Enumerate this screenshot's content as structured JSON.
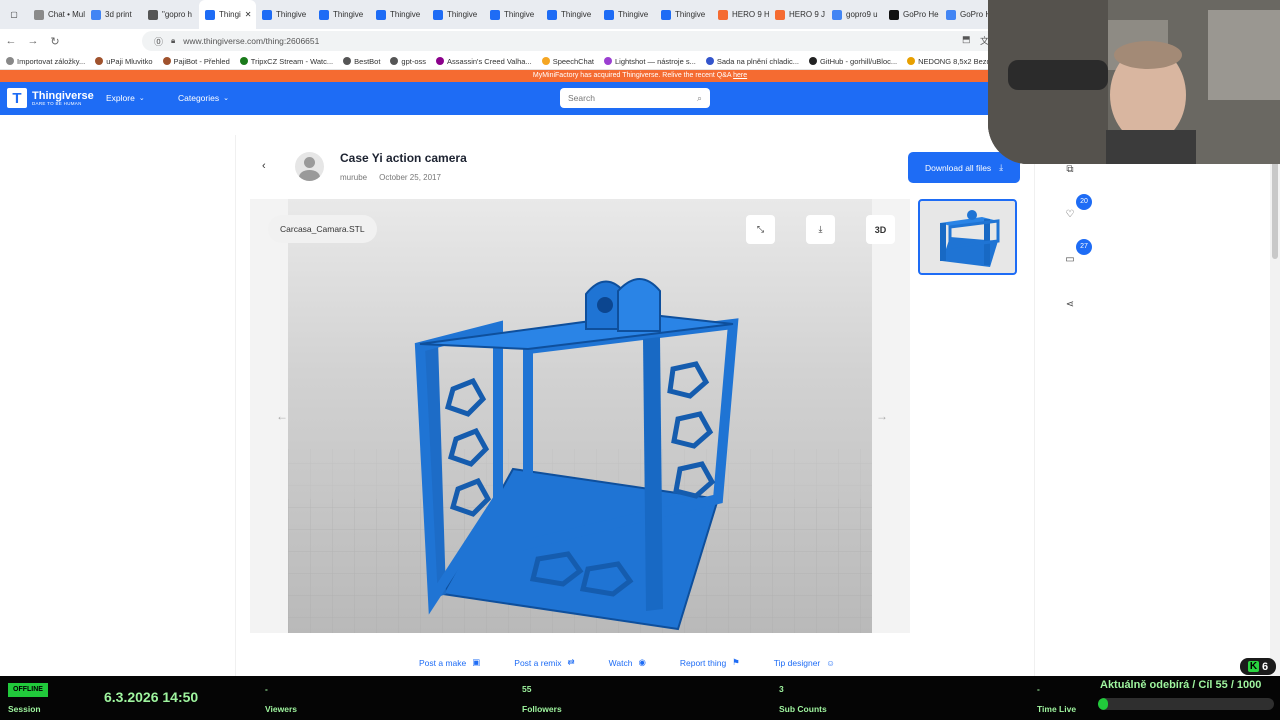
{
  "browser": {
    "tabs": [
      {
        "label": "Chat • MultiC",
        "color": "#8a8a8a"
      },
      {
        "label": "3d print",
        "color": "#4285f4"
      },
      {
        "label": "\"gopro h",
        "color": "#555555"
      },
      {
        "label": "Thingi",
        "color": "#1e6cf5",
        "active": true
      },
      {
        "label": "Thingive",
        "color": "#1e6cf5"
      },
      {
        "label": "Thingive",
        "color": "#1e6cf5"
      },
      {
        "label": "Thingive",
        "color": "#1e6cf5"
      },
      {
        "label": "Thingive",
        "color": "#1e6cf5"
      },
      {
        "label": "Thingive",
        "color": "#1e6cf5"
      },
      {
        "label": "Thingive",
        "color": "#1e6cf5"
      },
      {
        "label": "Thingive",
        "color": "#1e6cf5"
      },
      {
        "label": "Thingive",
        "color": "#1e6cf5"
      },
      {
        "label": "HERO 9 H",
        "color": "#f56b31"
      },
      {
        "label": "HERO 9 J",
        "color": "#f56b31"
      },
      {
        "label": "gopro9 u",
        "color": "#4285f4"
      },
      {
        "label": "GoPro He",
        "color": "#111111"
      },
      {
        "label": "GoPro He",
        "color": "#4285f4"
      }
    ],
    "url": "www.thingiverse.com/thing:2606651",
    "bookmarks": [
      {
        "label": "Importovat záložky...",
        "color": "#888888"
      },
      {
        "label": "uPaji Mluvitko",
        "color": "#a0522d"
      },
      {
        "label": "PajiBot - Přehled",
        "color": "#a0522d"
      },
      {
        "label": "TripxCZ Stream - Watc...",
        "color": "#1a7a1a"
      },
      {
        "label": "BestBot",
        "color": "#555555"
      },
      {
        "label": "gpt-oss",
        "color": "#555555"
      },
      {
        "label": "Assassin's Creed Valha...",
        "color": "#8b008b"
      },
      {
        "label": "SpeechChat",
        "color": "#f5a623"
      },
      {
        "label": "Lightshot — nástroje s...",
        "color": "#9b3fd1"
      },
      {
        "label": "Sada na plnění chladic...",
        "color": "#3355cc"
      },
      {
        "label": "GitHub - gorhill/uBloc...",
        "color": "#222222"
      },
      {
        "label": "NEDONG 8,5x2 Bezdu...",
        "color": "#e8a000"
      }
    ]
  },
  "announcement": {
    "text": "MyMiniFactory has acquired Thingiverse. Relive the recent Q&A",
    "link": "here"
  },
  "nav": {
    "brand": "Thingiverse",
    "tagline": "DARE TO BE HUMAN",
    "explore": "Explore",
    "categories": "Categories",
    "search_placeholder": "Search"
  },
  "thing": {
    "title": "Case Yi action camera",
    "author": "murube",
    "date": "October 25, 2017",
    "download_all": "Download all files",
    "file_name": "Carcasa_Camara.STL",
    "likes": "20",
    "collections": "27"
  },
  "actions": [
    {
      "label": "Post a make",
      "icon": "image-icon"
    },
    {
      "label": "Post a remix",
      "icon": "shuffle-icon"
    },
    {
      "label": "Watch",
      "icon": "eye-icon"
    },
    {
      "label": "Report thing",
      "icon": "flag-icon"
    },
    {
      "label": "Tip designer",
      "icon": "smile-icon"
    }
  ],
  "stream": {
    "status": "OFFLINE",
    "session_label": "Session",
    "datetime": "6.3.2026 14:50",
    "viewers_value": "-",
    "viewers_label": "Viewers",
    "followers_value": "55",
    "followers_label": "Followers",
    "subs_value": "3",
    "subs_label": "Sub Counts",
    "timelive_value": "-",
    "timelive_label": "Time Live",
    "goal_text": "Aktuálně odebírá / Cíl",
    "goal_value": "55 / 1000",
    "goal_fraction": 0.055,
    "kick_count": "6"
  },
  "colors": {
    "brand": "#1e6cf5",
    "announce": "#f56b31",
    "stream_green": "#21c93b",
    "model_blue": "#1f74d4"
  }
}
